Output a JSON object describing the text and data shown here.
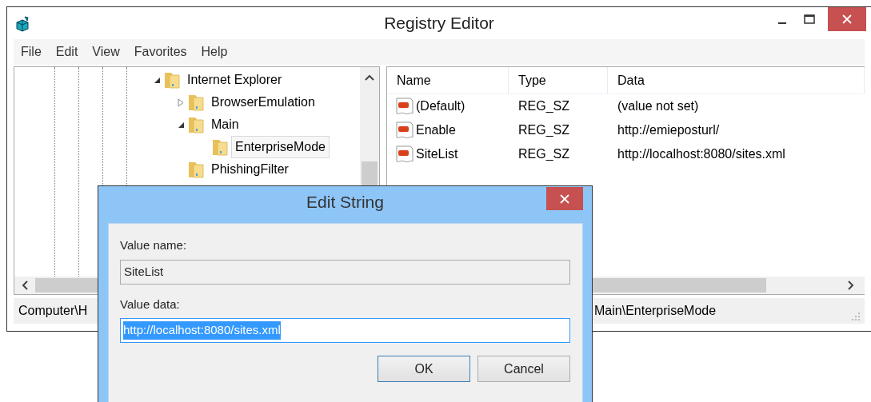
{
  "window": {
    "title": "Registry Editor"
  },
  "menu": [
    "File",
    "Edit",
    "View",
    "Favorites",
    "Help"
  ],
  "tree": [
    {
      "label": "Internet Explorer",
      "expanded": true,
      "selected": false,
      "children": [
        {
          "label": "BrowserEmulation",
          "expanded": false,
          "selected": false
        },
        {
          "label": "Main",
          "expanded": true,
          "selected": false,
          "children": [
            {
              "label": "EnterpriseMode",
              "selected": true
            }
          ]
        },
        {
          "label": "PhishingFilter",
          "selected": false
        }
      ]
    }
  ],
  "table": {
    "columns": [
      "Name",
      "Type",
      "Data"
    ],
    "rows": [
      {
        "name": "(Default)",
        "type": "REG_SZ",
        "data": "(value not set)"
      },
      {
        "name": "Enable",
        "type": "REG_SZ",
        "data": "http://emieposturl/"
      },
      {
        "name": "SiteList",
        "type": "REG_SZ",
        "data": "http://localhost:8080/sites.xml"
      }
    ]
  },
  "status_bar": {
    "path_start": "Computer\\H",
    "path_end": "Main\\EnterpriseMode"
  },
  "dialog": {
    "title": "Edit String",
    "value_name_label": "Value name:",
    "value_name": "SiteList",
    "value_data_label": "Value data:",
    "value_data": "http://localhost:8080/sites.xml",
    "value_data_selected": true,
    "buttons": [
      {
        "label": "OK",
        "default": true
      },
      {
        "label": "Cancel",
        "default": false
      }
    ]
  }
}
